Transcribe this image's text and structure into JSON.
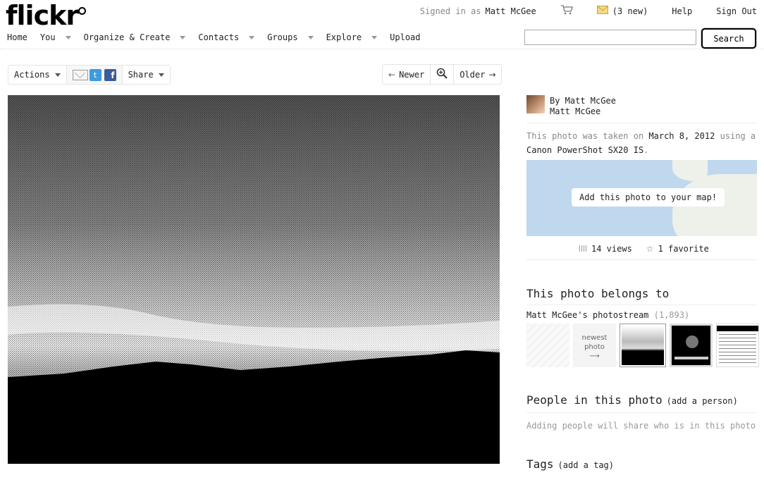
{
  "logo": {
    "text_main": "flick",
    "text_r": "r"
  },
  "topbar": {
    "signed_in_prefix": "Signed in as",
    "user_name": "Matt McGee",
    "mail_count": "(3 new)",
    "help": "Help",
    "sign_out": "Sign Out"
  },
  "nav": {
    "items": [
      {
        "label": "Home"
      },
      {
        "label": "You"
      },
      {
        "label": "Organize & Create"
      },
      {
        "label": "Contacts"
      },
      {
        "label": "Groups"
      },
      {
        "label": "Explore"
      },
      {
        "label": "Upload"
      }
    ],
    "search_value": "",
    "search_button": "Search"
  },
  "photo_toolbar": {
    "actions": "Actions",
    "share": "Share",
    "twitter_glyph": "t",
    "facebook_glyph": "f",
    "newer": "Newer",
    "older": "Older"
  },
  "owner": {
    "by_line": "By Matt McGee",
    "name": "Matt McGee"
  },
  "taken": {
    "prefix": "This photo was taken on",
    "date": "March 8, 2012",
    "mid": "using a",
    "camera": "Canon PowerShot SX20 IS",
    "suffix": "."
  },
  "map": {
    "add_label": "Add this photo to your map!"
  },
  "stats": {
    "views": "14 views",
    "favorites": "1 favorite"
  },
  "belongs": {
    "heading": "This photo belongs to",
    "stream_label": "Matt McGee's photostream",
    "stream_count": "(1,893)",
    "newest_line1": "newest",
    "newest_line2": "photo",
    "newest_arrow": "⟶"
  },
  "people": {
    "heading": "People in this photo",
    "add_link": "(add a person)",
    "note": "Adding people will share who is in this photo"
  },
  "tags": {
    "heading": "Tags",
    "add_link": "(add a tag)"
  },
  "colors": {
    "map_water": "#bfd8ee",
    "twitter": "#3d9be0",
    "facebook": "#3b5b99"
  }
}
